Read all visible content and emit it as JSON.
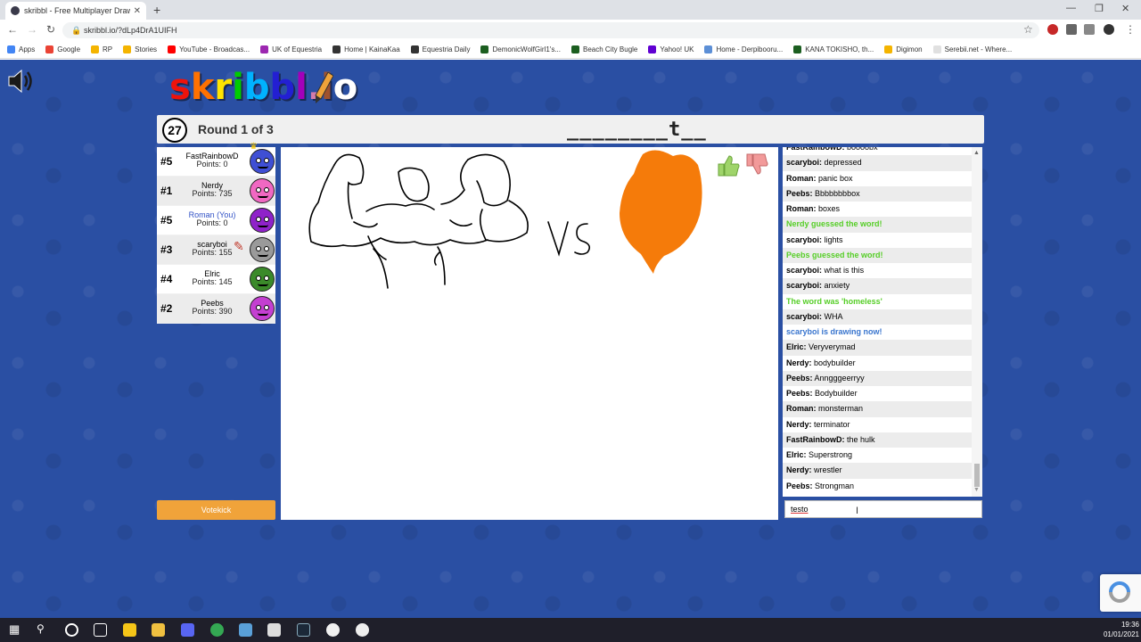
{
  "browser": {
    "tab_title": "skribbl - Free Multiplayer Drawi...",
    "tab_close": "✕",
    "new_tab": "+",
    "url": "skribbl.io/?dLp4DrA1UIFH",
    "bookmarks": [
      "Apps",
      "Google",
      "RP",
      "Stories",
      "YouTube - Broadcas...",
      "UK of Equestria",
      "Home | KainaKaa",
      "Equestria Daily",
      "DemonicWolfGirl1's...",
      "Beach City Bugle",
      "Yahoo! UK",
      "Home - Derpibooru...",
      "KANA TOKISHO, th...",
      "Digimon",
      "Serebii.net - Where..."
    ],
    "bookmark_colors": [
      "#4285f4",
      "#ea4335",
      "#f4b400",
      "#f4b400",
      "#ff0000",
      "#9c27b0",
      "#333333",
      "#333333",
      "#1b5e20",
      "#1b5e20",
      "#6001d2",
      "#5c8fd6",
      "#1b5e20",
      "#f4b400",
      "#e0e0e0"
    ]
  },
  "game": {
    "logo_letters": [
      "s",
      "k",
      "r",
      "i",
      "b",
      "b",
      "l",
      ".",
      "i",
      "o"
    ],
    "logo_colors": [
      "#ef130b",
      "#ff7100",
      "#ffe400",
      "#00cc00",
      "#00b2ff",
      "#231fd3",
      "#a300ba",
      "#d37caa",
      "#a0522d",
      "#ffffff"
    ],
    "timer": "27",
    "round_text": "Round 1 of 3",
    "word_hint": "________t__",
    "votekick_label": "Votekick",
    "chat_input_value": "testo"
  },
  "players": [
    {
      "rank": "#5",
      "name": "FastRainbowD",
      "points": "Points: 0",
      "color": "#3f4fd4",
      "crown": true,
      "you": false,
      "drawing": false
    },
    {
      "rank": "#1",
      "name": "Nerdy",
      "points": "Points: 735",
      "color": "#f068c2",
      "crown": false,
      "you": false,
      "drawing": false
    },
    {
      "rank": "#5",
      "name": "Roman (You)",
      "points": "Points: 0",
      "color": "#8f22c9",
      "crown": false,
      "you": true,
      "drawing": false
    },
    {
      "rank": "#3",
      "name": "scaryboi",
      "points": "Points: 155",
      "color": "#9a9a9a",
      "crown": false,
      "you": false,
      "drawing": true
    },
    {
      "rank": "#4",
      "name": "Elric",
      "points": "Points: 145",
      "color": "#3b8a2a",
      "crown": false,
      "you": false,
      "drawing": false
    },
    {
      "rank": "#2",
      "name": "Peebs",
      "points": "Points: 390",
      "color": "#c43fd1",
      "crown": false,
      "you": false,
      "drawing": false
    }
  ],
  "chat": [
    {
      "type": "msg",
      "user": "FastRainbowD:",
      "text": "boooobx"
    },
    {
      "type": "msg",
      "user": "scaryboi:",
      "text": "depressed"
    },
    {
      "type": "msg",
      "user": "Roman:",
      "text": "panic box"
    },
    {
      "type": "msg",
      "user": "Peebs:",
      "text": "Bbbbbbbbox"
    },
    {
      "type": "msg",
      "user": "Roman:",
      "text": "boxes"
    },
    {
      "type": "green",
      "text": "Nerdy guessed the word!"
    },
    {
      "type": "msg",
      "user": "scaryboi:",
      "text": "lights"
    },
    {
      "type": "green",
      "text": "Peebs guessed the word!"
    },
    {
      "type": "msg",
      "user": "scaryboi:",
      "text": "what is this"
    },
    {
      "type": "msg",
      "user": "scaryboi:",
      "text": "anxiety"
    },
    {
      "type": "green",
      "text": "The word was 'homeless'"
    },
    {
      "type": "msg",
      "user": "scaryboi:",
      "text": "WHA"
    },
    {
      "type": "blue",
      "text": "scaryboi is drawing now!"
    },
    {
      "type": "msg",
      "user": "Elric:",
      "text": "Veryverymad"
    },
    {
      "type": "msg",
      "user": "Nerdy:",
      "text": "bodybuilder"
    },
    {
      "type": "msg",
      "user": "Peebs:",
      "text": "Anngggeerryy"
    },
    {
      "type": "msg",
      "user": "Peebs:",
      "text": "Bodybuilder"
    },
    {
      "type": "msg",
      "user": "Roman:",
      "text": "monsterman"
    },
    {
      "type": "msg",
      "user": "Nerdy:",
      "text": "terminator"
    },
    {
      "type": "msg",
      "user": "FastRainbowD:",
      "text": "the hulk"
    },
    {
      "type": "msg",
      "user": "Elric:",
      "text": "Superstrong"
    },
    {
      "type": "msg",
      "user": "Nerdy:",
      "text": "wrestler"
    },
    {
      "type": "msg",
      "user": "Peebs:",
      "text": "Strongman"
    }
  ],
  "colors": {
    "page_bg": "#2a4fa3",
    "green_msg": "#56ce27",
    "blue_msg": "#3975ce",
    "votekick": "#f0a33a",
    "drawing_orange": "#f57b0a"
  },
  "taskbar": {
    "time": "19:36",
    "date": "01/01/2021"
  }
}
